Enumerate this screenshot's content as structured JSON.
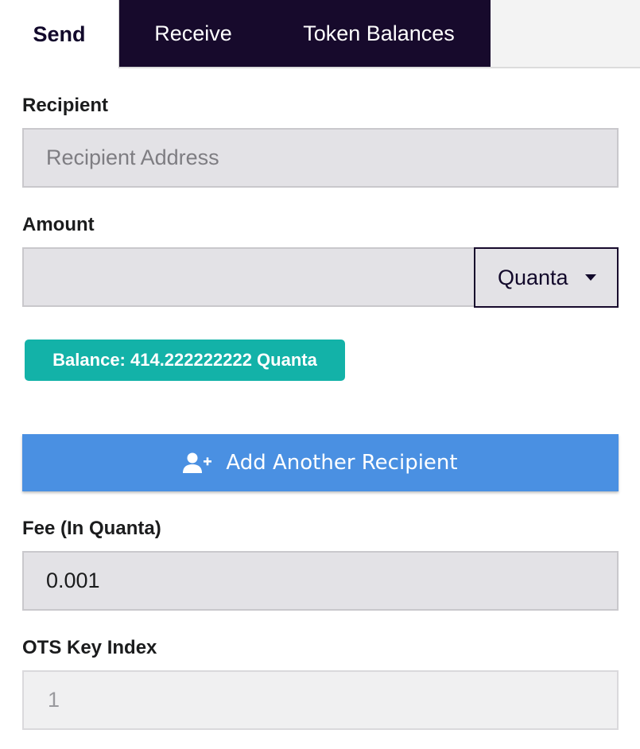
{
  "tabs": {
    "send": "Send",
    "receive": "Receive",
    "token_balances": "Token Balances"
  },
  "recipient": {
    "label": "Recipient",
    "placeholder": "Recipient Address",
    "value": ""
  },
  "amount": {
    "label": "Amount",
    "value": "",
    "unit": "Quanta"
  },
  "balance": {
    "text": "Balance: 414.222222222 Quanta"
  },
  "add_recipient": {
    "label": "Add Another Recipient",
    "icon": "user-plus-icon"
  },
  "fee": {
    "label": "Fee (In Quanta)",
    "value": "0.001"
  },
  "ots": {
    "label": "OTS Key Index",
    "value": "1"
  },
  "colors": {
    "dark_tab": "#170a2c",
    "badge": "#13b2a8",
    "button": "#4a90e2",
    "input_bg": "#e3e2e6"
  }
}
